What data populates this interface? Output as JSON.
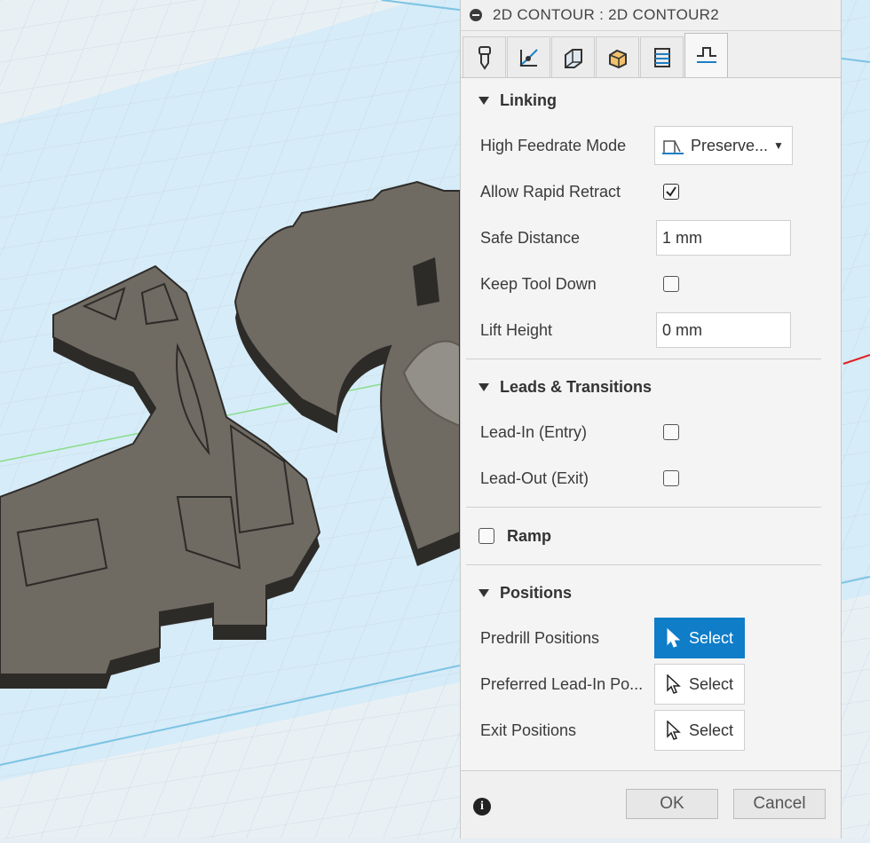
{
  "dialog": {
    "title": "2D CONTOUR : 2D CONTOUR2",
    "tabs": [
      {
        "icon": "tool-icon",
        "active": false
      },
      {
        "icon": "geometry-icon",
        "active": false
      },
      {
        "icon": "heights-icon",
        "active": false
      },
      {
        "icon": "passes-icon",
        "active": false
      },
      {
        "icon": "linking-passes-icon",
        "active": false
      },
      {
        "icon": "linking-icon",
        "active": true
      }
    ]
  },
  "linking": {
    "header": "Linking",
    "high_feedrate_mode": {
      "label": "High Feedrate Mode",
      "value": "Preserve..."
    },
    "allow_rapid_retract": {
      "label": "Allow Rapid Retract",
      "checked": true
    },
    "safe_distance": {
      "label": "Safe Distance",
      "value": "1 mm"
    },
    "keep_tool_down": {
      "label": "Keep Tool Down",
      "checked": false
    },
    "lift_height": {
      "label": "Lift Height",
      "value": "0 mm"
    }
  },
  "leads": {
    "header": "Leads & Transitions",
    "lead_in": {
      "label": "Lead-In (Entry)",
      "checked": false
    },
    "lead_out": {
      "label": "Lead-Out (Exit)",
      "checked": false
    }
  },
  "ramp": {
    "label": "Ramp",
    "checked": false
  },
  "positions": {
    "header": "Positions",
    "predrill": {
      "label": "Predrill Positions",
      "button": "Select",
      "active": true
    },
    "preferred_lead_in": {
      "label": "Preferred Lead-In Po...",
      "button": "Select",
      "active": false
    },
    "exit": {
      "label": "Exit Positions",
      "button": "Select",
      "active": false
    }
  },
  "footer": {
    "ok": "OK",
    "cancel": "Cancel"
  },
  "colors": {
    "accent": "#0f7dc8",
    "part": "#6f6a62",
    "part_edge": "#2d2b28",
    "grid_plane": "#d9eef8"
  }
}
